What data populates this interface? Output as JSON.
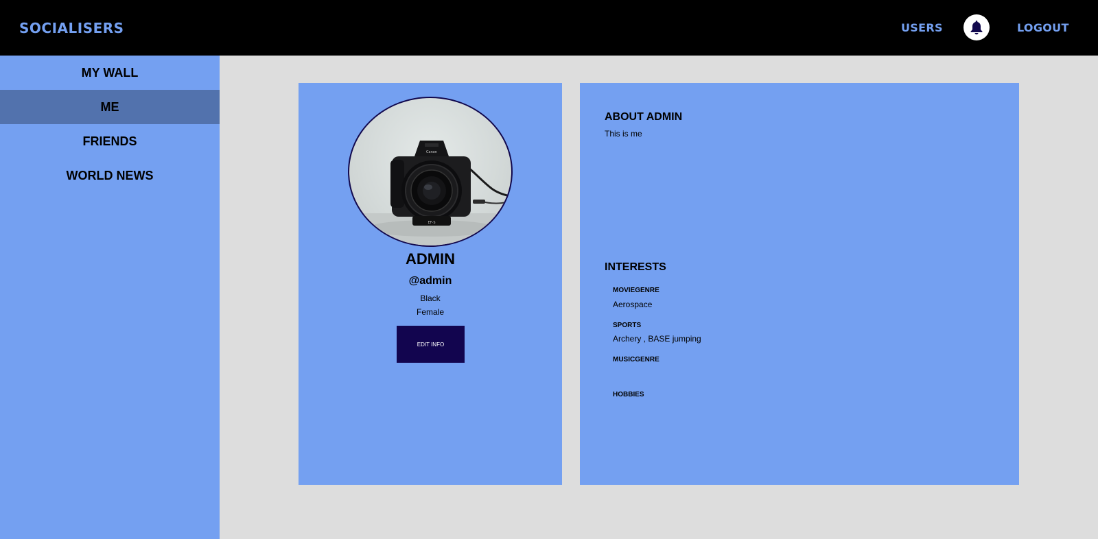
{
  "header": {
    "brand": "SOCIALISERS",
    "users_label": "USERS",
    "logout_label": "LOGOUT",
    "bell_icon": "bell-icon"
  },
  "sidebar": {
    "items": [
      {
        "label": "MY WALL",
        "active": false
      },
      {
        "label": "ME",
        "active": true
      },
      {
        "label": "FRIENDS",
        "active": false
      },
      {
        "label": "WORLD NEWS",
        "active": false
      }
    ]
  },
  "profile": {
    "name": "ADMIN",
    "handle": "@admin",
    "line1": "Black",
    "line2": "Female",
    "edit_label": "EDIT INFO",
    "avatar_icon": "camera-photo"
  },
  "about": {
    "title": "ABOUT ADMIN",
    "text": "This is me"
  },
  "interests": {
    "title": "INTERESTS",
    "items": [
      {
        "label": "MOVIEGENRE",
        "value": "Aerospace"
      },
      {
        "label": "SPORTS",
        "value": "Archery , BASE jumping"
      },
      {
        "label": "MUSICGENRE",
        "value": ""
      },
      {
        "label": "HOBBIES",
        "value": ""
      }
    ]
  },
  "colors": {
    "accent": "#74a0f1",
    "active_sidebar": "#5272ad",
    "button": "#12054f",
    "background": "#dddddd",
    "topbar": "#000000"
  }
}
